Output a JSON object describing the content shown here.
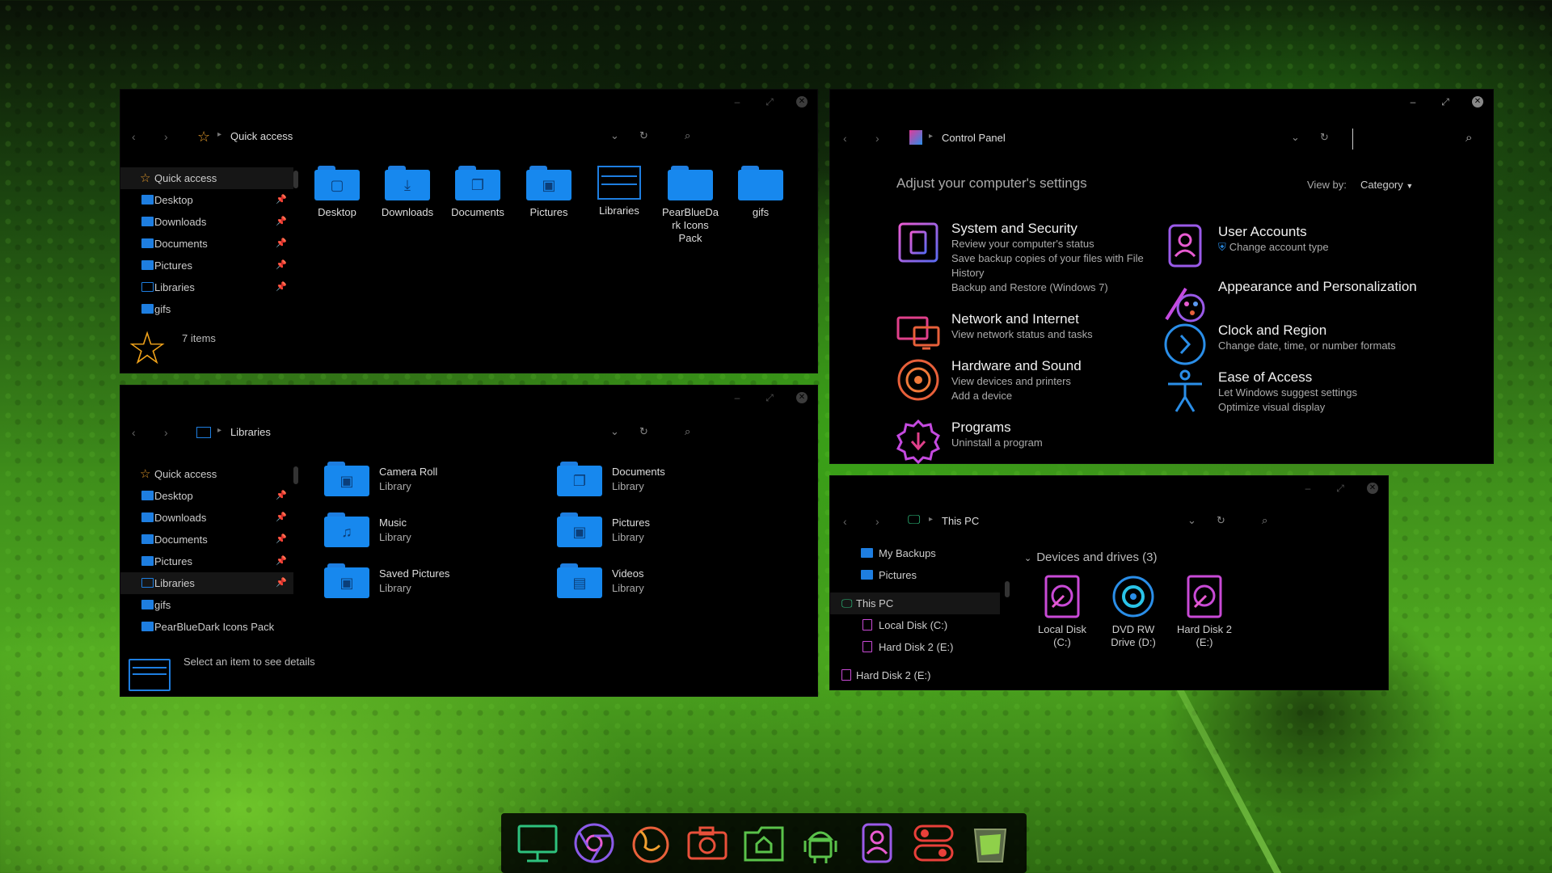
{
  "quick_access_window": {
    "crumb": "Quick access",
    "sidebar": [
      {
        "label": "Quick access",
        "icon": "star-icon",
        "pinned": false,
        "selected": true
      },
      {
        "label": "Desktop",
        "icon": "folder-icon",
        "pinned": true
      },
      {
        "label": "Downloads",
        "icon": "folder-icon",
        "pinned": true
      },
      {
        "label": "Documents",
        "icon": "folder-icon",
        "pinned": true
      },
      {
        "label": "Pictures",
        "icon": "folder-icon",
        "pinned": true
      },
      {
        "label": "Libraries",
        "icon": "library-icon",
        "pinned": true
      },
      {
        "label": "gifs",
        "icon": "folder-icon",
        "pinned": false
      }
    ],
    "items": [
      {
        "label": "Desktop",
        "glyph": "▢"
      },
      {
        "label": "Downloads",
        "glyph": "⤓"
      },
      {
        "label": "Documents",
        "glyph": "❐"
      },
      {
        "label": "Pictures",
        "glyph": "▣"
      },
      {
        "label": "Libraries",
        "glyph": ""
      },
      {
        "label": "PearBlueDa\nrk Icons\nPack",
        "glyph": ""
      },
      {
        "label": "gifs",
        "glyph": ""
      }
    ],
    "status": "7 items"
  },
  "libraries_window": {
    "crumb": "Libraries",
    "sidebar": [
      {
        "label": "Quick access",
        "pinned": false
      },
      {
        "label": "Desktop",
        "pinned": true
      },
      {
        "label": "Downloads",
        "pinned": true
      },
      {
        "label": "Documents",
        "pinned": true
      },
      {
        "label": "Pictures",
        "pinned": true
      },
      {
        "label": "Libraries",
        "pinned": true,
        "selected": true
      },
      {
        "label": "gifs",
        "pinned": false
      },
      {
        "label": "PearBlueDark Icons Pack",
        "pinned": false
      }
    ],
    "items": [
      {
        "name": "Camera Roll",
        "sub": "Library",
        "glyph": "▣"
      },
      {
        "name": "Documents",
        "sub": "Library",
        "glyph": "❐"
      },
      {
        "name": "Music",
        "sub": "Library",
        "glyph": "♫"
      },
      {
        "name": "Pictures",
        "sub": "Library",
        "glyph": "▣"
      },
      {
        "name": "Saved Pictures",
        "sub": "Library",
        "glyph": "▣"
      },
      {
        "name": "Videos",
        "sub": "Library",
        "glyph": "▤"
      }
    ],
    "details": "Select an item to see details"
  },
  "control_panel": {
    "crumb": "Control Panel",
    "heading": "Adjust your computer's settings",
    "view_by_label": "View by:",
    "view_by_value": "Category",
    "left": [
      {
        "title": "System and Security",
        "links": [
          "Review your computer's status",
          "Save backup copies of your files with File History",
          "Backup and Restore (Windows 7)"
        ]
      },
      {
        "title": "Network and Internet",
        "links": [
          "View network status and tasks"
        ]
      },
      {
        "title": "Hardware and Sound",
        "links": [
          "View devices and printers",
          "Add a device"
        ]
      },
      {
        "title": "Programs",
        "links": [
          "Uninstall a program"
        ]
      }
    ],
    "right": [
      {
        "title": "User Accounts",
        "links": [
          "Change account type"
        ]
      },
      {
        "title": "Appearance and Personalization",
        "links": []
      },
      {
        "title": "Clock and Region",
        "links": [
          "Change date, time, or number formats"
        ]
      },
      {
        "title": "Ease of Access",
        "links": [
          "Let Windows suggest settings",
          "Optimize visual display"
        ]
      }
    ]
  },
  "this_pc_window": {
    "crumb": "This PC",
    "sidebar": [
      {
        "label": "My Backups",
        "icon": "folder-icon"
      },
      {
        "label": "Pictures",
        "icon": "folder-icon"
      },
      {
        "label": "This PC",
        "icon": "computer-icon",
        "selected": true
      },
      {
        "label": "Local Disk (C:)",
        "icon": "disk-icon"
      },
      {
        "label": "Hard Disk 2 (E:)",
        "icon": "disk-icon"
      },
      {
        "label": "Hard Disk 2 (E:)",
        "icon": "disk-icon"
      }
    ],
    "group_title": "Devices and drives (3)",
    "drives": [
      {
        "label": "Local Disk\n(C:)"
      },
      {
        "label": "DVD RW\nDrive (D:)"
      },
      {
        "label": "Hard Disk 2\n(E:)"
      }
    ]
  },
  "taskbar": [
    "monitor-icon",
    "chrome-icon",
    "firefox-icon",
    "camera-icon",
    "home-folder-icon",
    "android-icon",
    "contacts-icon",
    "toggle-icon",
    "recycle-bin-icon"
  ],
  "colors": {
    "accent_blue": "#1788ee",
    "folder_blue": "#1e7ee0",
    "window_bg": "#000000"
  }
}
